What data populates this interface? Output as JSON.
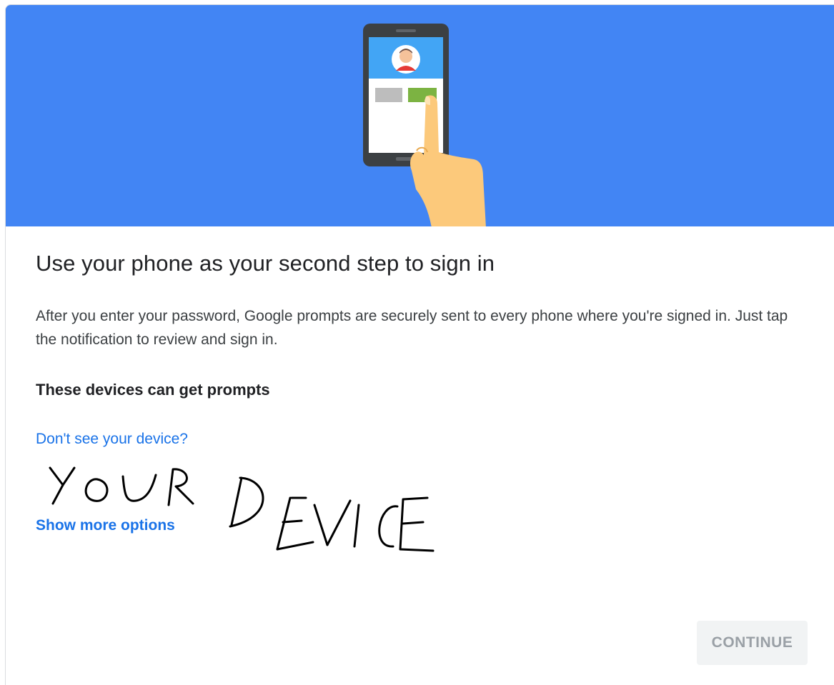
{
  "hero": {
    "illustration_icon": "phone-tap-illustration",
    "background_color": "#4285f4"
  },
  "title": "Use your phone as your second step to sign in",
  "description": "After you enter your password, Google prompts are securely sent to every phone where you're signed in. Just tap the notification to review and sign in.",
  "devices_heading": "These devices can get prompts",
  "links": {
    "dont_see_device": "Don't see your device?",
    "show_more_options": "Show more options"
  },
  "handwritten_annotation": "YOUR DEVICE",
  "continue_button": {
    "label": "CONTINUE",
    "state": "disabled"
  },
  "colors": {
    "link": "#1a73e8",
    "title": "#202124",
    "body_text": "#3c4043",
    "disabled_button_bg": "#f1f3f4",
    "disabled_button_text": "#9aa0a6"
  }
}
